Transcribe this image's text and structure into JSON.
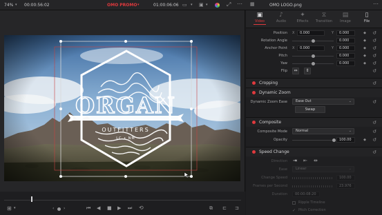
{
  "topbar": {
    "zoom": "74%",
    "source_timecode": "00:00:56:02",
    "timeline_name": "OMO PROMO",
    "record_timecode": "01:00:06:06",
    "clip_name": "OMO LOGO.png",
    "icons": [
      "layout-icon",
      "monitor-icon",
      "color-wheel-icon",
      "expand-icon",
      "more-icon",
      "inspector-icon"
    ]
  },
  "colors": {
    "accent": "#e0393d",
    "panel": "#1f1f21",
    "field": "#141416"
  },
  "graphic": {
    "logo_title": "ORGAN",
    "logo_subtitle": "OUTFITTERS",
    "logo_location": "LC • NM"
  },
  "inspector": {
    "tabs": [
      {
        "label": "Video",
        "icon": "video-icon",
        "active": true
      },
      {
        "label": "Audio",
        "icon": "audio-icon",
        "active": false
      },
      {
        "label": "Effects",
        "icon": "effects-icon",
        "active": false
      },
      {
        "label": "Transition",
        "icon": "transition-icon",
        "active": false
      },
      {
        "label": "Image",
        "icon": "image-icon",
        "active": false
      },
      {
        "label": "File",
        "icon": "file-icon",
        "active": false
      }
    ],
    "transform": {
      "position": {
        "label": "Position",
        "x_axis": "X",
        "x": "0.000",
        "y_axis": "Y",
        "y": "0.000"
      },
      "rotation": {
        "label": "Rotation Angle",
        "value": "0.000"
      },
      "anchor": {
        "label": "Anchor Point",
        "x_axis": "X",
        "x": "0.000",
        "y_axis": "Y",
        "y": "0.000"
      },
      "pitch": {
        "label": "Pitch",
        "value": "0.000"
      },
      "yaw": {
        "label": "Yaw",
        "value": "0.000"
      },
      "flip": {
        "label": "Flip"
      }
    },
    "cropping": {
      "title": "Cropping"
    },
    "dynamic_zoom": {
      "title": "Dynamic Zoom",
      "ease_label": "Dynamic Zoom Ease",
      "ease_value": "Ease Out",
      "swap_label": "Swap"
    },
    "composite": {
      "title": "Composite",
      "mode_label": "Composite Mode",
      "mode_value": "Normal",
      "opacity_label": "Opacity",
      "opacity_value": "100.00",
      "opacity_level": 1.0
    },
    "speed_change": {
      "title": "Speed Change",
      "direction_label": "Direction",
      "ease_label": "Ease",
      "ease_value": "Linear",
      "change_speed_label": "Change Speed",
      "change_speed_value": "100.00",
      "frames_per_second_label": "Frames per Second",
      "frames_per_second_value": "23.976",
      "duration_label": "Duration",
      "duration_value": "00:00:08:20",
      "ripple_label": "Ripple Timeline",
      "pitch_correction_label": "Pitch Correction"
    }
  },
  "transport": {
    "playhead_fraction": 0.115
  }
}
